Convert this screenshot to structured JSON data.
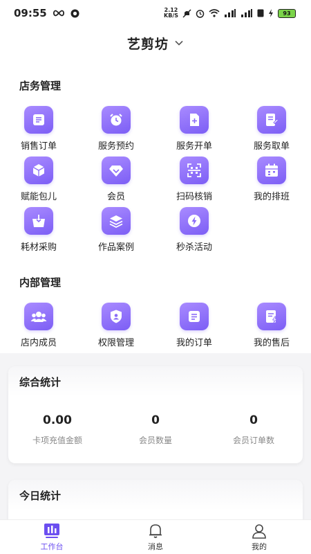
{
  "status_bar": {
    "time": "09:55",
    "speed_value": "2.12",
    "speed_unit": "KB/S",
    "battery": "93"
  },
  "header": {
    "title": "艺剪坊"
  },
  "store_management": {
    "title": "店务管理",
    "items": [
      {
        "label": "销售订单",
        "icon": "order-list-icon"
      },
      {
        "label": "服务预约",
        "icon": "alarm-clock-icon"
      },
      {
        "label": "服务开单",
        "icon": "add-document-icon"
      },
      {
        "label": "服务取单",
        "icon": "document-edit-icon"
      },
      {
        "label": "赋能包儿",
        "icon": "cube-icon"
      },
      {
        "label": "会员",
        "icon": "diamond-icon"
      },
      {
        "label": "扫码核销",
        "icon": "scan-icon"
      },
      {
        "label": "我的排班",
        "icon": "calendar-icon"
      },
      {
        "label": "耗材采购",
        "icon": "box-icon"
      },
      {
        "label": "作品案例",
        "icon": "layers-icon"
      },
      {
        "label": "秒杀活动",
        "icon": "flash-icon"
      }
    ]
  },
  "internal_management": {
    "title": "内部管理",
    "items": [
      {
        "label": "店内成员",
        "icon": "members-icon"
      },
      {
        "label": "权限管理",
        "icon": "shield-user-icon"
      },
      {
        "label": "我的订单",
        "icon": "my-order-icon"
      },
      {
        "label": "我的售后",
        "icon": "after-sales-icon"
      }
    ]
  },
  "overall_stats": {
    "title": "综合统计",
    "items": [
      {
        "value": "0.00",
        "label": "卡项充值金额"
      },
      {
        "value": "0",
        "label": "会员数量"
      },
      {
        "value": "0",
        "label": "会员订单数"
      }
    ]
  },
  "today_stats": {
    "title": "今日统计"
  },
  "tabbar": {
    "tabs": [
      {
        "label": "工作台",
        "icon": "workbench-icon",
        "active": true
      },
      {
        "label": "消息",
        "icon": "bell-icon",
        "active": false
      },
      {
        "label": "我的",
        "icon": "user-icon",
        "active": false
      }
    ]
  },
  "colors": {
    "accent": "#7c5ef5",
    "accent_light": "#a98bff"
  }
}
